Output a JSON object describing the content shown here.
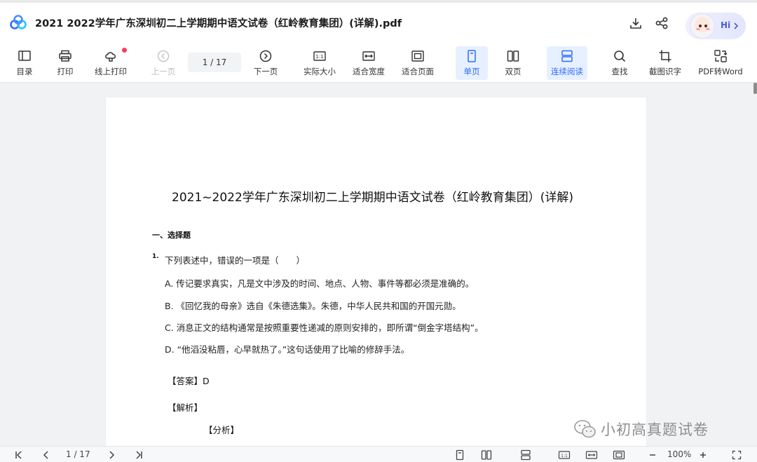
{
  "window": {
    "title": "2021 2022学年广东深圳初二上学期期中语文试卷（红岭教育集团）(详解).pdf",
    "assistant_label": "Hi"
  },
  "toolbar": {
    "toc": "目录",
    "print": "打印",
    "online_print": "线上打印",
    "prev_page": "上一页",
    "page_indicator": "1  / 17",
    "next_page": "下一页",
    "actual_size": "实际大小",
    "fit_width": "适合宽度",
    "fit_page": "适合页面",
    "single_page": "单页",
    "double_page": "双页",
    "continuous": "连续阅读",
    "find": "查找",
    "ocr": "截图识字",
    "pdf_to_word": "PDF转Word"
  },
  "document": {
    "heading": "2021~2022学年广东深圳初二上学期期中语文试卷（红岭教育集团）(详解)",
    "section": "一、选择题",
    "q1_number": "1.",
    "q1_stem": "下列表述中，错误的一项是（　　）",
    "options": [
      "A. 传记要求真实，凡是文中涉及的时间、地点、人物、事件等都必须是准确的。",
      "B. 《回忆我的母亲》选自《朱德选集》。朱德，中华人民共和国的开国元勋。",
      "C. 消息正文的结构通常是按照重要性递减的原则安排的，即所谓“倒金字塔结构”。",
      "D. “他滔没粘唇，心早就热了。”这句话使用了比喻的修辞手法。"
    ],
    "answer_label": "【答案】",
    "answer_value": "D",
    "analysis_label": "【解析】",
    "sub_analysis_label": "【分析】"
  },
  "bottombar": {
    "page_indicator": "1 / 17",
    "zoom": "100%"
  },
  "watermark": {
    "text": "小初高真题试卷"
  },
  "colors": {
    "accent": "#2f6bff",
    "active_bg": "#e7f0ff",
    "notification": "#ff3b5c"
  }
}
